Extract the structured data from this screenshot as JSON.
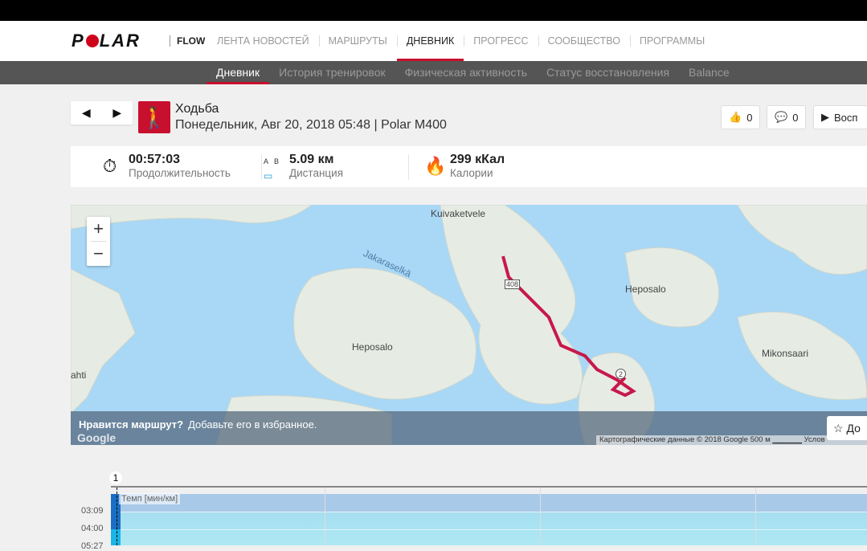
{
  "nav": {
    "logo": "POLAR",
    "flow": "FLOW",
    "items": [
      "ЛЕНТА НОВОСТЕЙ",
      "МАРШРУТЫ",
      "ДНЕВНИК",
      "ПРОГРЕСС",
      "СООБЩЕСТВО",
      "ПРОГРАММЫ"
    ],
    "active": 2
  },
  "subnav": {
    "items": [
      "Дневник",
      "История тренировок",
      "Физическая активность",
      "Статус восстановления",
      "Balance"
    ],
    "active": 0
  },
  "session": {
    "sport": "Ходьба",
    "subtitle": "Понедельник, Авг 20, 2018 05:48 | Polar M400",
    "likes": "0",
    "comments": "0",
    "play": "Восп"
  },
  "stats": {
    "duration": {
      "value": "00:57:03",
      "label": "Продолжительность"
    },
    "distance": {
      "value": "5.09 км",
      "label": "Дистанция",
      "ab": "A   B"
    },
    "calories": {
      "value": "299 кКал",
      "label": "Калории"
    }
  },
  "map": {
    "labels": [
      "Kuivaketvele",
      "Jakaraselkä",
      "Heposalo",
      "Heposalo",
      "Mikonsaari",
      "ahti",
      "408"
    ],
    "zoom_in": "+",
    "zoom_out": "−",
    "banner_bold": "Нравится маршрут?",
    "banner_text": "Добавьте его в избранное.",
    "favorite": "До",
    "attribution": "Картографические данные © 2018 Google   500 м ▁▁▁▁▁   Услов",
    "google": "Google",
    "lap_marker": "2",
    "route_color": "#c8184a"
  },
  "chart": {
    "lap_marker": "1",
    "series_label": "Темп [мин/км]",
    "y_ticks": [
      "03:09",
      "04:00",
      "05:27"
    ]
  }
}
